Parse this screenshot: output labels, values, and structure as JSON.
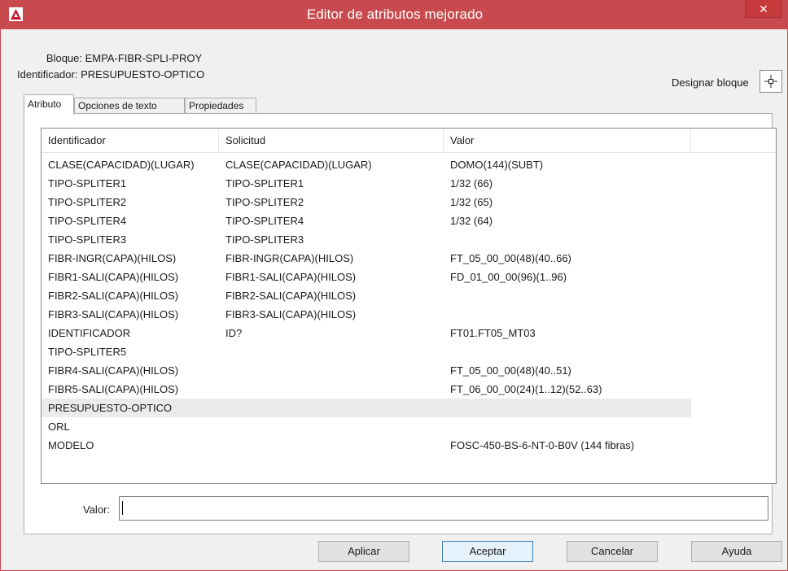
{
  "window": {
    "title": "Editor de atributos mejorado",
    "close_glyph": "✕",
    "app_icon": "autocad-icon"
  },
  "info": {
    "block_label": "Bloque:",
    "block_value": "EMPA-FIBR-SPLI-PROY",
    "id_label": "Identificador:",
    "id_value": "PRESUPUESTO-OPTICO",
    "designate_label": "Designar bloque",
    "designate_icon": "crosshair-pick-icon"
  },
  "tabs": [
    {
      "label": "Atributo",
      "active": true
    },
    {
      "label": "Opciones de texto",
      "active": false
    },
    {
      "label": "Propiedades",
      "active": false
    }
  ],
  "table": {
    "headers": [
      "Identificador",
      "Solicitud",
      "Valor"
    ],
    "rows": [
      {
        "tag": "CLASE(CAPACIDAD)(LUGAR)",
        "prompt": "CLASE(CAPACIDAD)(LUGAR)",
        "value": "DOMO(144)(SUBT)"
      },
      {
        "tag": "TIPO-SPLITER1",
        "prompt": "TIPO-SPLITER1",
        "value": "1/32 (66)"
      },
      {
        "tag": "TIPO-SPLITER2",
        "prompt": "TIPO-SPLITER2",
        "value": "1/32 (65)"
      },
      {
        "tag": "TIPO-SPLITER4",
        "prompt": "TIPO-SPLITER4",
        "value": "1/32 (64)"
      },
      {
        "tag": "TIPO-SPLITER3",
        "prompt": "TIPO-SPLITER3",
        "value": ""
      },
      {
        "tag": "FIBR-INGR(CAPA)(HILOS)",
        "prompt": "FIBR-INGR(CAPA)(HILOS)",
        "value": "FT_05_00_00(48)(40..66)"
      },
      {
        "tag": "FIBR1-SALI(CAPA)(HILOS)",
        "prompt": "FIBR1-SALI(CAPA)(HILOS)",
        "value": "FD_01_00_00(96)(1..96)"
      },
      {
        "tag": "FIBR2-SALI(CAPA)(HILOS)",
        "prompt": "FIBR2-SALI(CAPA)(HILOS)",
        "value": ""
      },
      {
        "tag": "FIBR3-SALI(CAPA)(HILOS)",
        "prompt": "FIBR3-SALI(CAPA)(HILOS)",
        "value": ""
      },
      {
        "tag": "IDENTIFICADOR",
        "prompt": "ID?",
        "value": "FT01.FT05_MT03"
      },
      {
        "tag": "TIPO-SPLITER5",
        "prompt": "",
        "value": ""
      },
      {
        "tag": "FIBR4-SALI(CAPA)(HILOS)",
        "prompt": "",
        "value": "FT_05_00_00(48)(40..51)"
      },
      {
        "tag": "FIBR5-SALI(CAPA)(HILOS)",
        "prompt": "",
        "value": "FT_06_00_00(24)(1..12)(52..63)"
      },
      {
        "tag": "PRESUPUESTO-OPTICO",
        "prompt": "",
        "value": "",
        "selected": true
      },
      {
        "tag": "ORL",
        "prompt": "",
        "value": ""
      },
      {
        "tag": "MODELO",
        "prompt": "",
        "value": "FOSC-450-BS-6-NT-0-B0V (144 fibras)"
      }
    ]
  },
  "value_field": {
    "label": "Valor:",
    "value": ""
  },
  "buttons": {
    "apply": "Aplicar",
    "ok": "Aceptar",
    "cancel": "Cancelar",
    "help": "Ayuda"
  }
}
